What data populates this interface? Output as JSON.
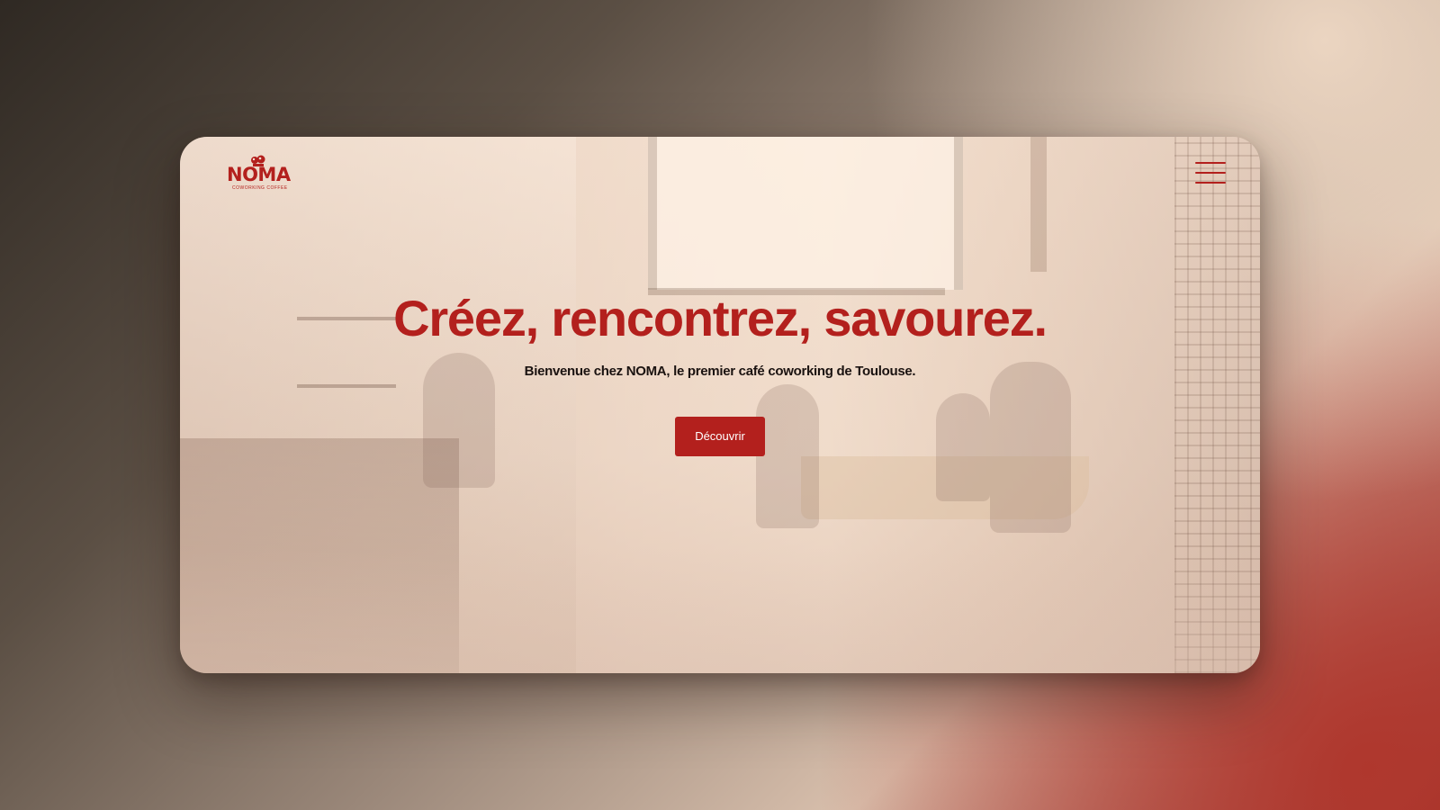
{
  "brand": {
    "name": "NOMA",
    "tagline": "coworking coffee",
    "primary_color": "#b3201d",
    "mascot_icon": "coffee-cup-mascot-icon"
  },
  "header": {
    "menu_icon": "hamburger-menu-icon"
  },
  "hero": {
    "title": "Créez, rencontrez, savourez.",
    "subtitle": "Bienvenue chez NOMA, le premier café coworking de Toulouse.",
    "cta_label": "Découvrir"
  }
}
